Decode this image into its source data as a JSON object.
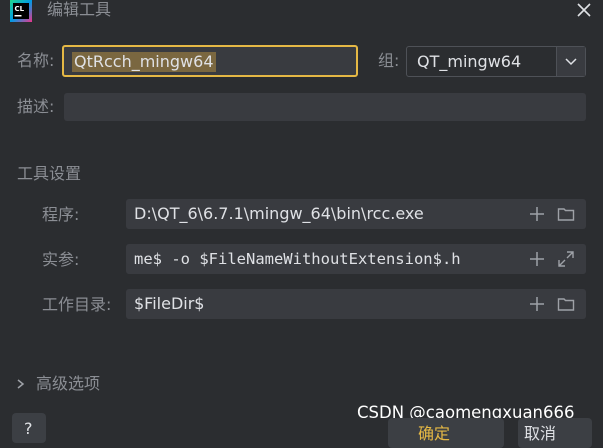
{
  "window": {
    "title": "编辑工具",
    "icon": "clion-logo",
    "icon_text": "CL",
    "close_icon": "close-icon"
  },
  "form": {
    "name_label": "名称:",
    "name_value": "QtRcch_mingw64",
    "group_label": "组:",
    "group_value": "QT_mingw64",
    "description_label": "描述:",
    "description_value": ""
  },
  "tool_settings": {
    "section_title": "工具设置",
    "program_label": "程序:",
    "program_value": "D:\\QT_6\\6.7.1\\mingw_64\\bin\\rcc.exe",
    "arguments_label": "实参:",
    "arguments_value": "me$ -o $FileNameWithoutExtension$.h",
    "workdir_label": "工作目录:",
    "workdir_value": "$FileDir$"
  },
  "advanced": {
    "label": "高级选项"
  },
  "footer": {
    "help_label": "?",
    "ok_label": "确定",
    "cancel_label": "取消"
  },
  "watermark": "CSDN @caomengxuan666",
  "colors": {
    "background": "#2b2d30",
    "field_bg": "#393b40",
    "focus_border": "#e5b845",
    "selection": "#7a6740",
    "text": "#dfe1e5",
    "label": "#8b8e94"
  }
}
